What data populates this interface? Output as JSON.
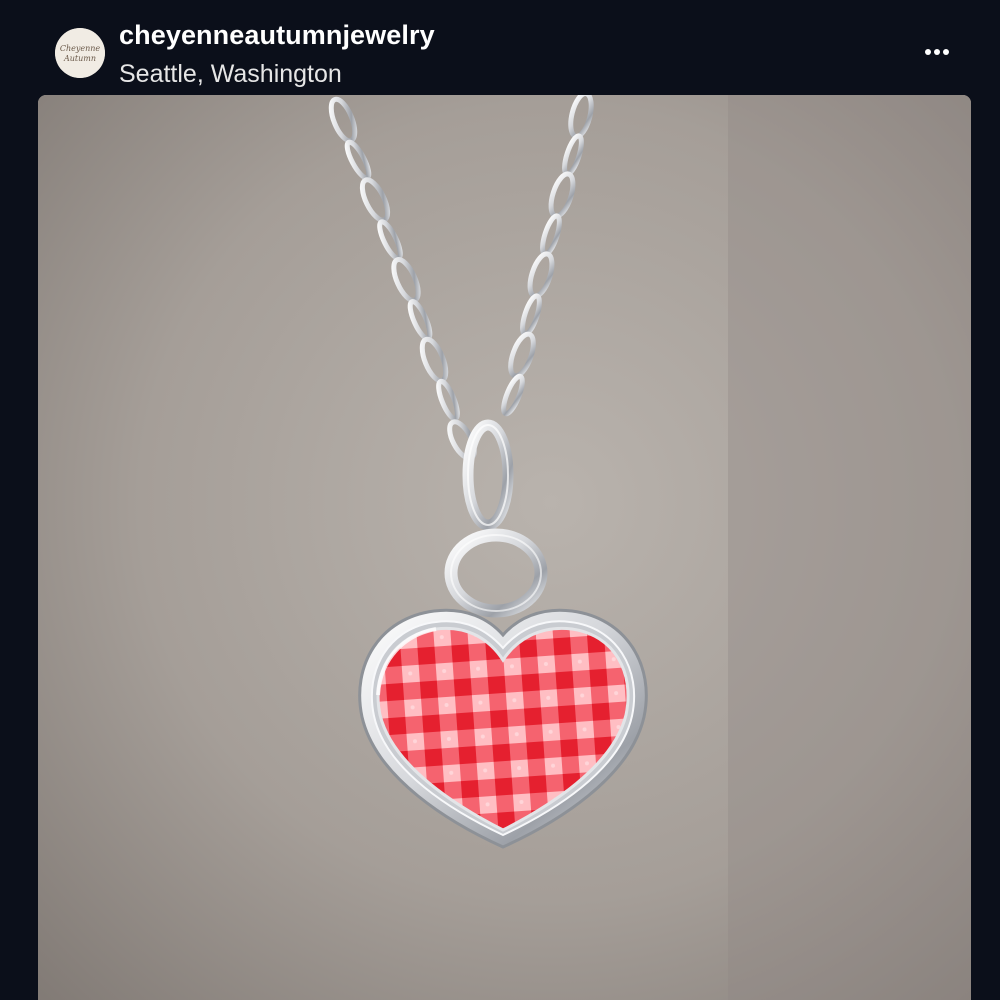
{
  "post": {
    "username": "cheyenneautumnjewelry",
    "location": "Seattle, Washington",
    "avatar_text": "Cheyenne Autumn",
    "more_icon": "more-horizontal-icon"
  },
  "photo": {
    "subject": "silver heart pendant necklace with red gingham inlay",
    "background_color": "#a49d97",
    "gingham_colors": [
      "#e8323b",
      "#ffd1d4",
      "#ff6f7a"
    ]
  },
  "colors": {
    "header_bg": "#0b0f1a",
    "username": "#ffffff",
    "location": "#e6e6e6"
  }
}
